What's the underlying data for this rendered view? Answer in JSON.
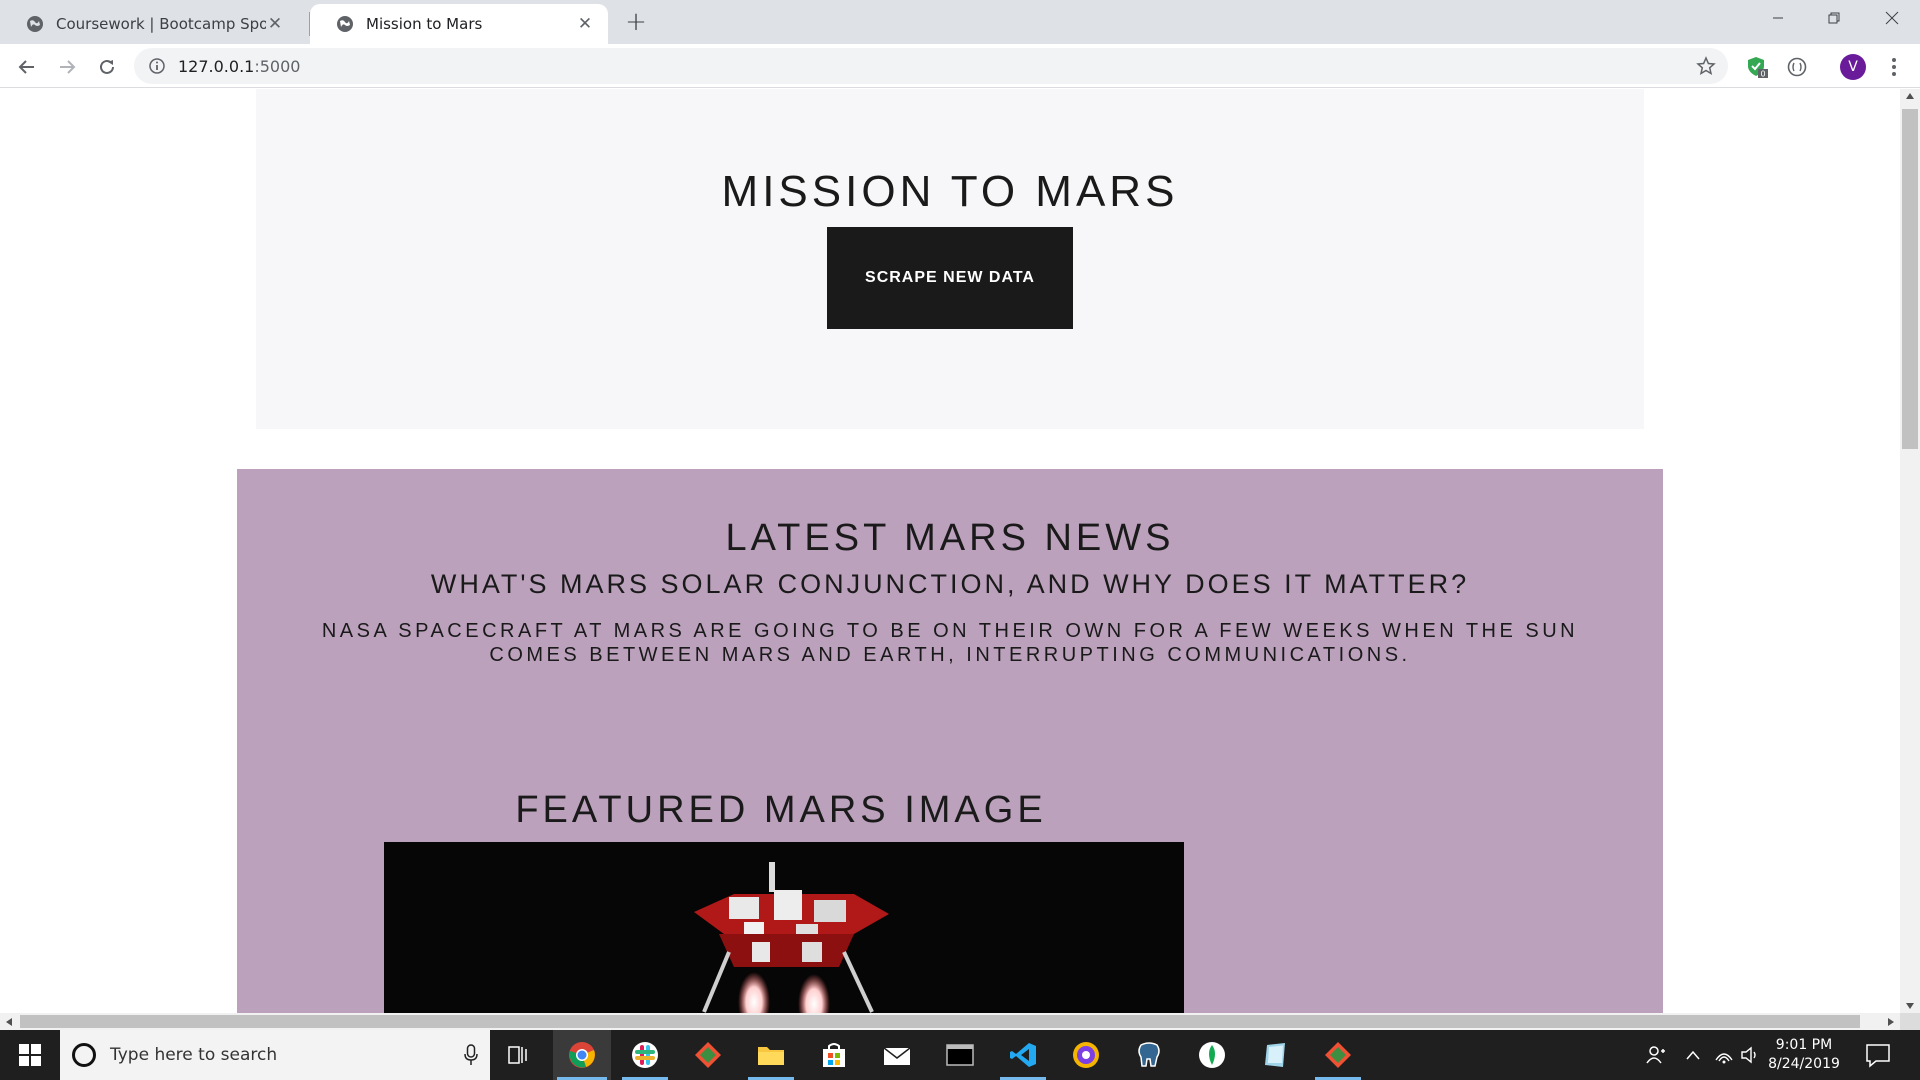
{
  "browser": {
    "tabs": [
      {
        "title": "Coursework | Bootcamp Spot",
        "active": false
      },
      {
        "title": "Mission to Mars",
        "active": true
      }
    ],
    "url_host": "127.0.0.1",
    "url_port": ":5000",
    "profile_initial": "V",
    "extension_badge": "0"
  },
  "page": {
    "title": "MISSION TO MARS",
    "scrape_button_label": "SCRAPE NEW DATA",
    "news": {
      "section_title": "LATEST MARS NEWS",
      "headline": "WHAT'S MARS SOLAR CONJUNCTION, AND WHY DOES IT MATTER?",
      "teaser": "NASA SPACECRAFT AT MARS ARE GOING TO BE ON THEIR OWN FOR A FEW WEEKS WHEN THE SUN COMES BETWEEN MARS AND EARTH, INTERRUPTING COMMUNICATIONS."
    },
    "featured_image": {
      "section_title": "FEATURED MARS IMAGE"
    },
    "colors": {
      "jumbotron_bg": "#f7f7f9",
      "news_bg": "#bca1bd",
      "button_bg": "#1a1a1a"
    }
  },
  "taskbar": {
    "search_placeholder": "Type here to search",
    "time": "9:01 PM",
    "date": "8/24/2019",
    "apps": [
      "chrome-icon",
      "slack-icon",
      "git-icon",
      "file-explorer-icon",
      "store-icon",
      "mail-icon",
      "terminal-icon",
      "vscode-icon",
      "brave-icon",
      "postgres-icon",
      "mongodb-icon",
      "notepad-icon",
      "gitkraken-icon"
    ]
  }
}
